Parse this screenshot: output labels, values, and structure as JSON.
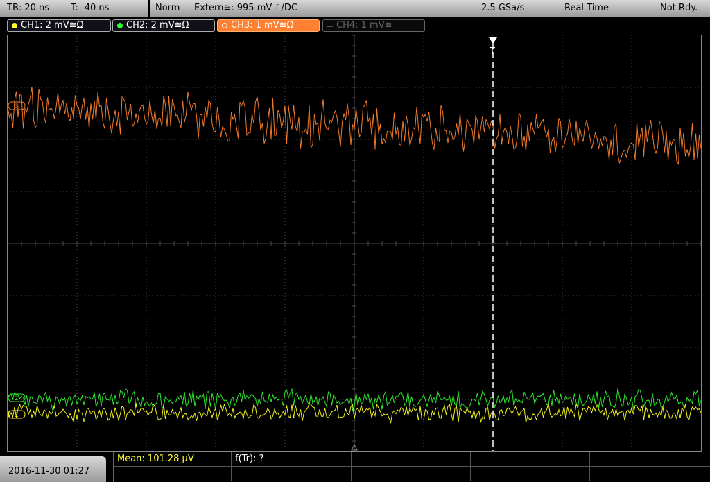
{
  "header": {
    "timebase": "TB: 20 ns",
    "trigger_time": "T: -40 ns",
    "mode": "Norm",
    "trigger_source": "Extern≅: 995 mV ⎍/DC",
    "sample_rate": "2.5 GSa/s",
    "acq_mode": "Real Time",
    "status": "Not Rdy."
  },
  "channels": [
    {
      "label": "CH1: 2 mV≅Ω",
      "color": "#ffff30",
      "active": true
    },
    {
      "label": "CH2: 2 mV≅Ω",
      "color": "#30ff30",
      "active": true
    },
    {
      "label": "CH3: 1 mV≅Ω",
      "color": "#ff7f27",
      "active": true,
      "selected": true
    },
    {
      "label": "CH4: 1 mV≅",
      "color": "#888888",
      "active": false
    }
  ],
  "markers": {
    "ch3": "3",
    "ch2": "2",
    "ch1": "1",
    "trigger": "T"
  },
  "footer": {
    "datetime": "2016-11-30 01:27",
    "mean": "Mean: 101.28 μV",
    "freq": "f(Tr): ?"
  },
  "colors": {
    "ch1": "#f2f21c",
    "ch2": "#2be82b",
    "ch3": "#f07a2a",
    "grid": "#4a4a4a"
  }
}
